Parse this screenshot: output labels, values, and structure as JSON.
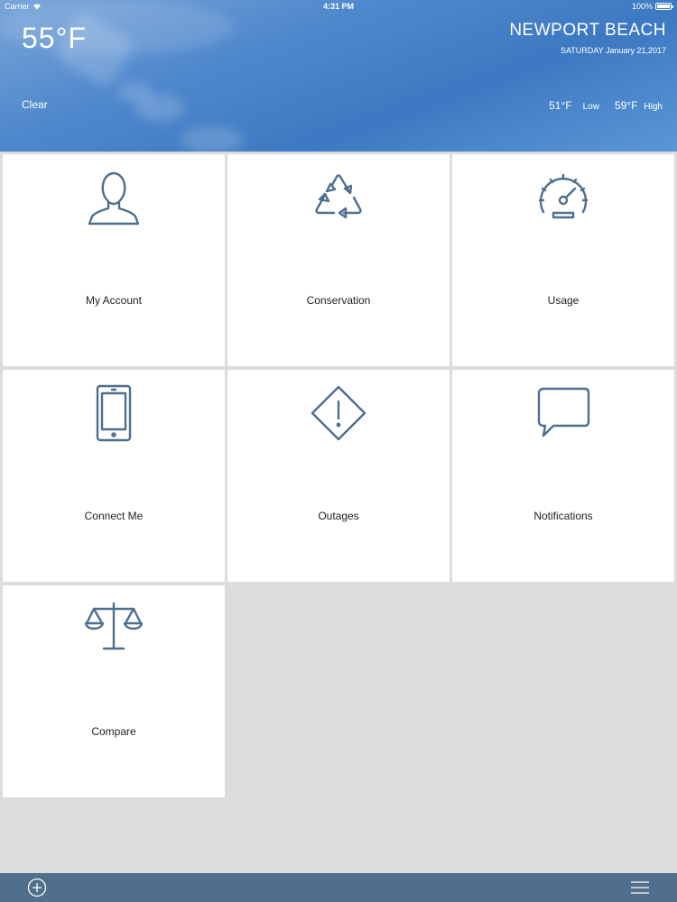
{
  "status_bar": {
    "carrier": "Carrier",
    "time": "4:31 PM",
    "battery": "100%",
    "battery_level": 1.0
  },
  "weather": {
    "temperature": "55°F",
    "city": "NEWPORT BEACH",
    "date": "SATURDAY January 21,2017",
    "condition": "Clear",
    "low_value": "51°F",
    "low_label": "Low",
    "high_value": "59°F",
    "high_label": "High"
  },
  "tiles": [
    {
      "label": "My Account",
      "icon": "person-icon"
    },
    {
      "label": "Conservation",
      "icon": "recycle-icon"
    },
    {
      "label": "Usage",
      "icon": "speedometer-icon"
    },
    {
      "label": "Connect Me",
      "icon": "phone-icon"
    },
    {
      "label": "Outages",
      "icon": "warning-diamond-icon"
    },
    {
      "label": "Notifications",
      "icon": "speech-bubble-icon"
    },
    {
      "label": "Compare",
      "icon": "balance-scale-icon"
    }
  ],
  "bottom_bar": {
    "left_icon": "add-circle-icon",
    "right_icon": "hamburger-menu-icon"
  },
  "colors": {
    "icon_stroke": "#4e6e8e",
    "bottom_bar": "#4f6f8c",
    "background": "#dcdbdd",
    "tile": "#ffffff"
  }
}
